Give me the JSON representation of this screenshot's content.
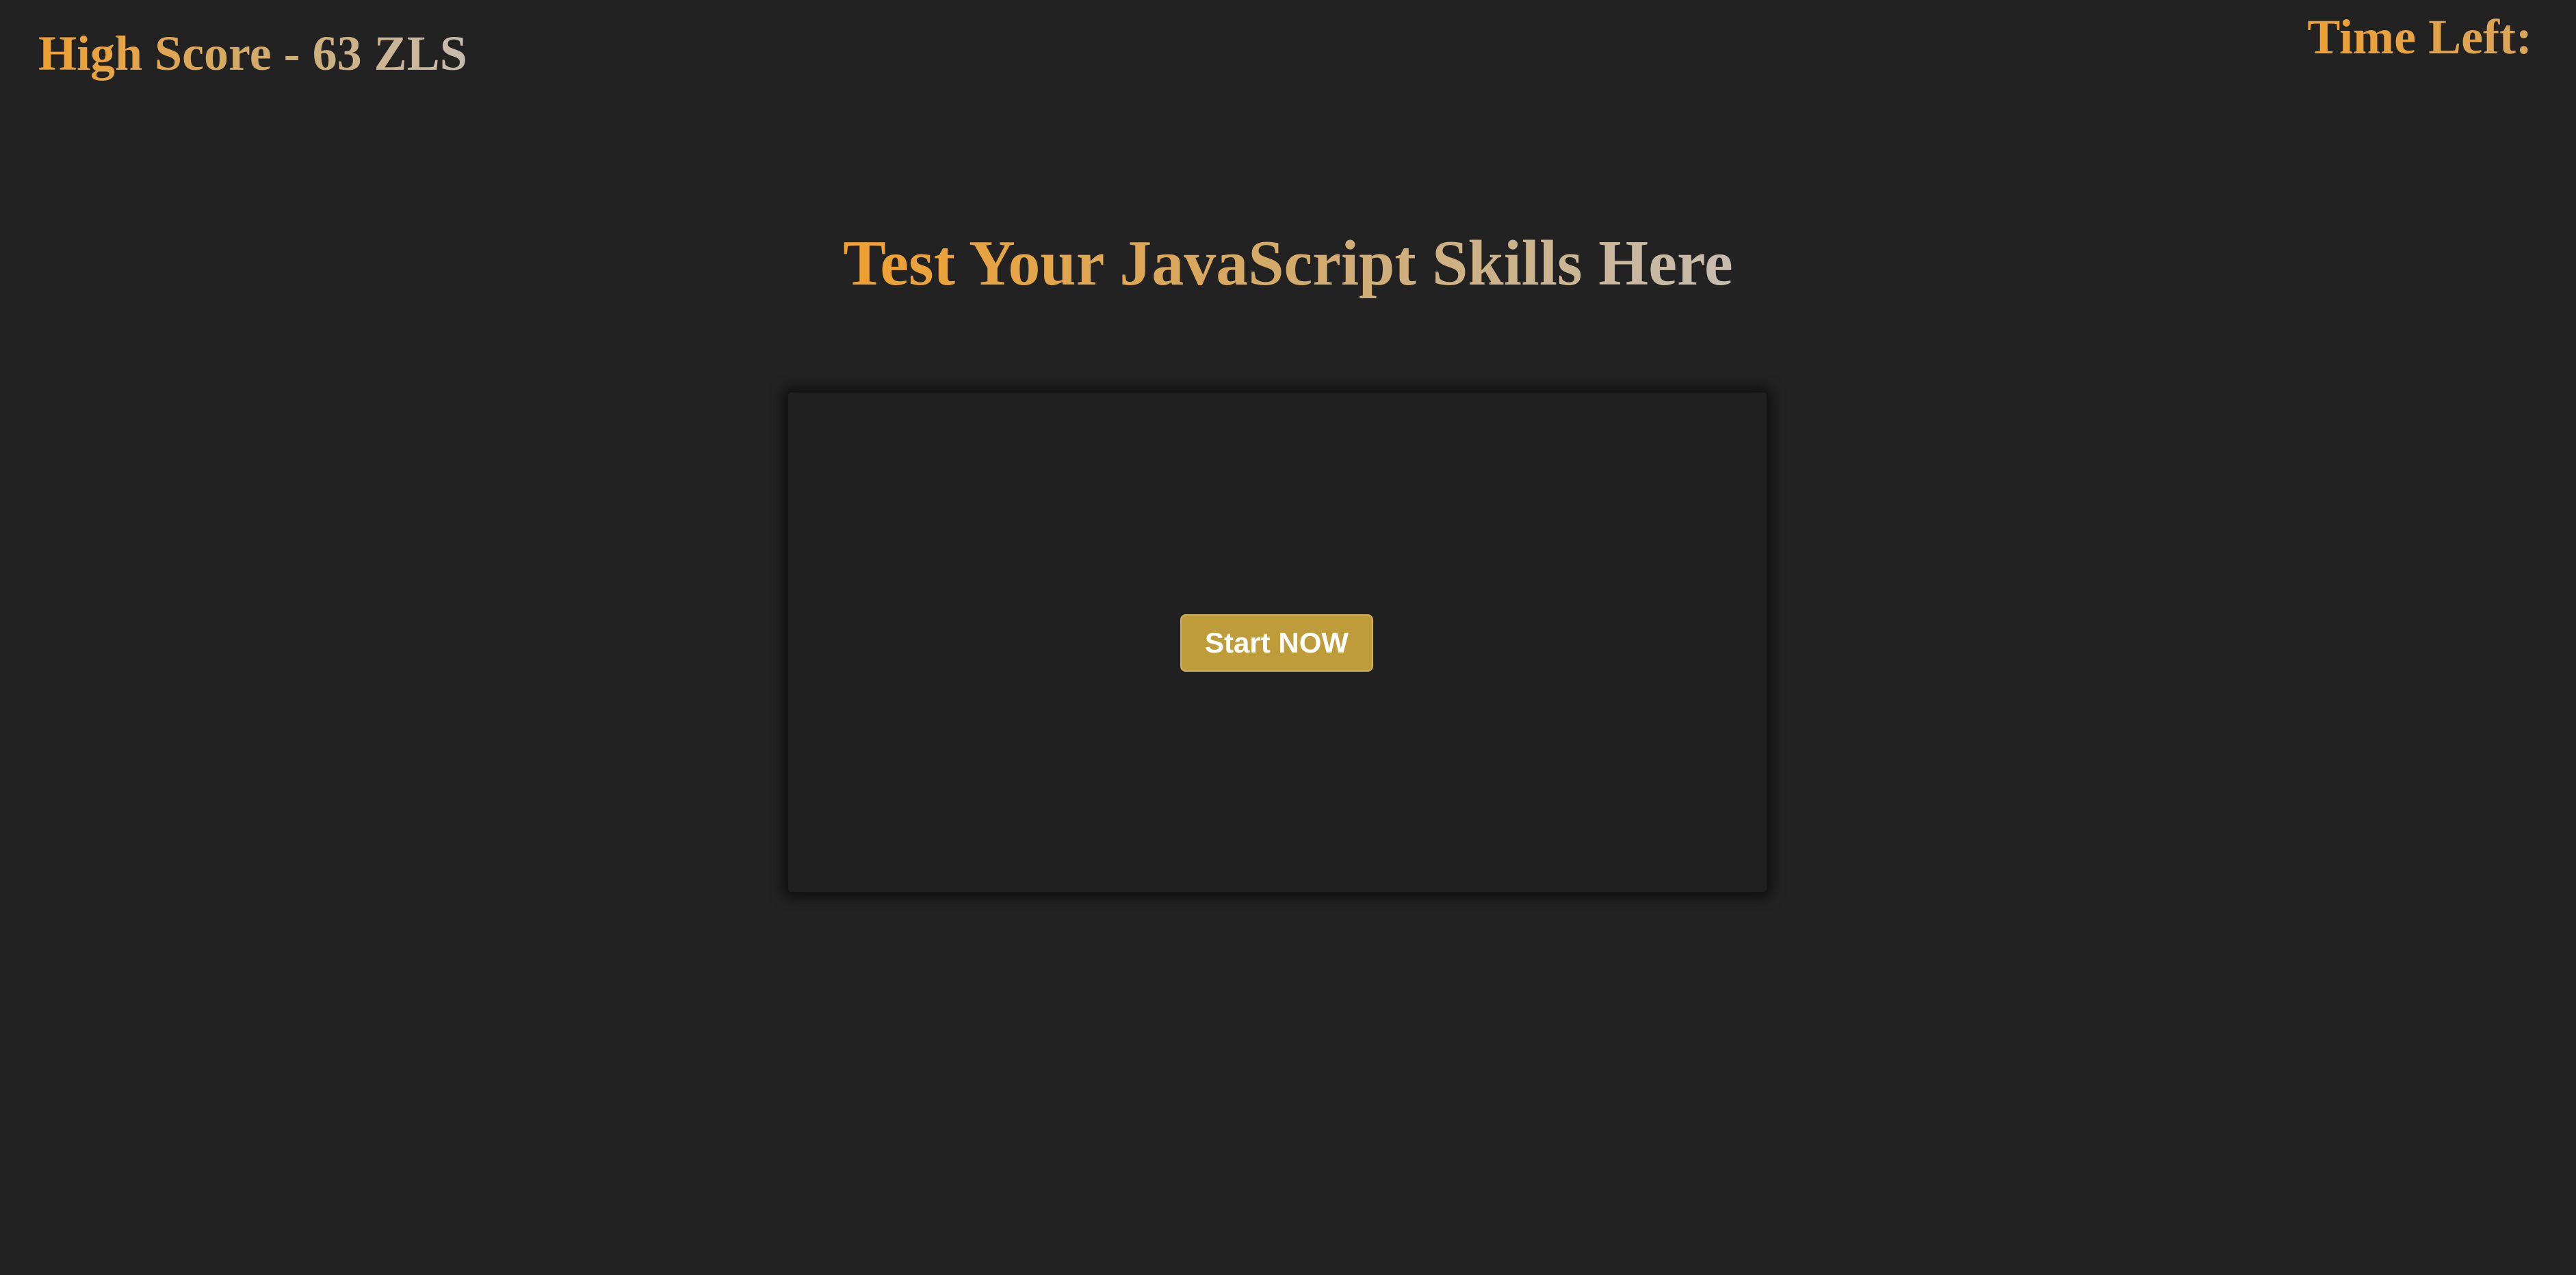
{
  "header": {
    "high_score": "High Score - 63 ZLS",
    "time_left": "Time Left:"
  },
  "main": {
    "title": "Test Your JavaScript Skills Here",
    "start_button_label": "Start NOW"
  },
  "colors": {
    "background": "#222222",
    "card_background": "#202020",
    "accent_orange": "#f0a030",
    "accent_gray": "#c6bcae",
    "button_gold": "#bf9c3a",
    "button_text": "#ffffff"
  }
}
